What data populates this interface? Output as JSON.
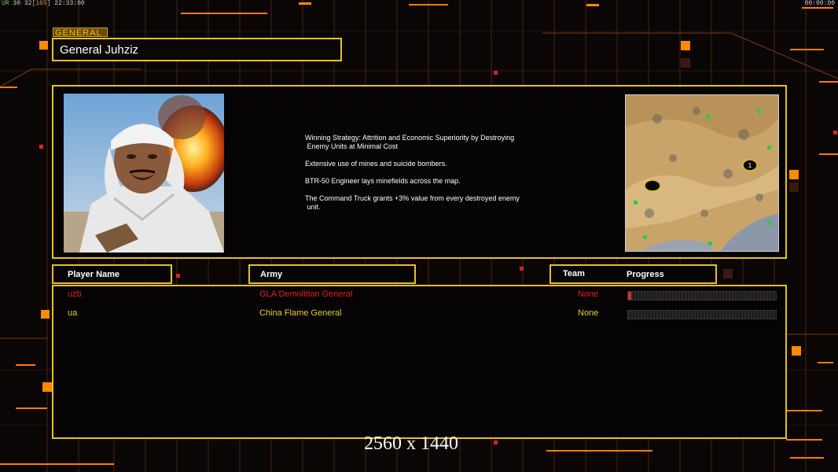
{
  "hud": {
    "left_prefix": "UR",
    "left_a": "30",
    "left_b": "32",
    "left_c": "[165]",
    "left_time": "22:33:00",
    "right_time": "00:00:00"
  },
  "general": {
    "tag": "GENERAL",
    "name": "General Juhziz"
  },
  "strategy": [
    "Winning Strategy: Attrition and Economic Superiority by Destroying\n Enemy Units at Minimal Cost",
    "Extensive use of mines and suicide bombers.",
    "BTR-50 Engineer lays minefields across the map.",
    "The Command Truck grants +3% value from every destroyed enemy\n unit."
  ],
  "headers": {
    "player_name": "Player Name",
    "army": "Army",
    "team": "Team",
    "progress": "Progress"
  },
  "players": [
    {
      "name": "uzb",
      "army": "GLA Demolition General",
      "team": "None",
      "progress": 0.02,
      "color": "#e02020"
    },
    {
      "name": "ua",
      "army": "China Flame General",
      "team": "None",
      "progress": 0,
      "color": "#e8d020"
    }
  ],
  "minimap": {
    "start_positions": [
      "1"
    ]
  },
  "footer": {
    "resolution": "2560 x 1440"
  },
  "colors": {
    "accent": "#e8c020",
    "background": "#0a0606",
    "decor_orange": "#ff8a00"
  }
}
